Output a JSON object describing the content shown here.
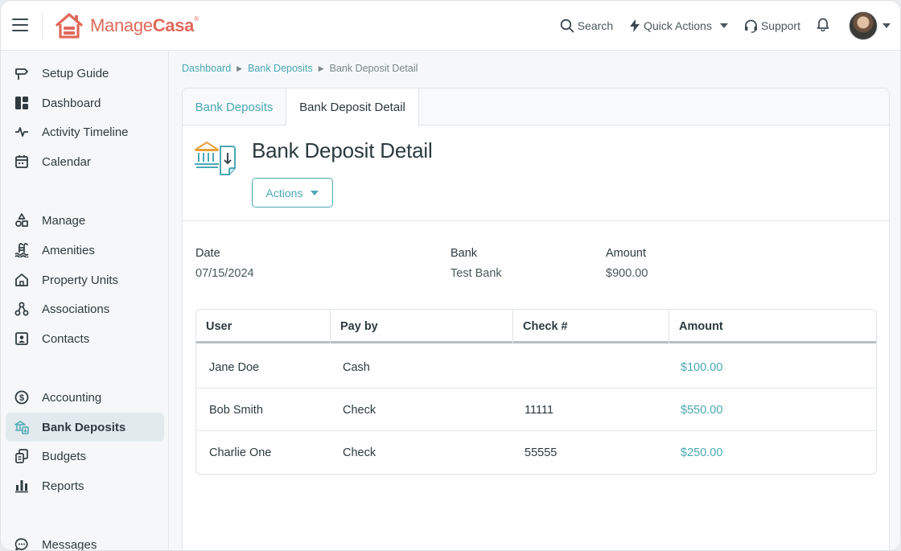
{
  "app": {
    "brand_prefix": "Manage",
    "brand_suffix": "Casa",
    "brand_mark": "®"
  },
  "topbar": {
    "search_label": "Search",
    "quick_actions_label": "Quick Actions",
    "support_label": "Support"
  },
  "sidebar": {
    "items": [
      {
        "label": "Setup Guide",
        "icon": "signpost-icon"
      },
      {
        "label": "Dashboard",
        "icon": "dashboard-icon"
      },
      {
        "label": "Activity Timeline",
        "icon": "pulse-icon"
      },
      {
        "label": "Calendar",
        "icon": "calendar-icon"
      },
      {
        "label": "Manage",
        "icon": "shapes-icon"
      },
      {
        "label": "Amenities",
        "icon": "pool-icon"
      },
      {
        "label": "Property Units",
        "icon": "house-icon"
      },
      {
        "label": "Associations",
        "icon": "network-icon"
      },
      {
        "label": "Contacts",
        "icon": "contact-card-icon"
      },
      {
        "label": "Accounting",
        "icon": "dollar-circle-icon"
      },
      {
        "label": "Bank Deposits",
        "icon": "bank-deposit-icon"
      },
      {
        "label": "Budgets",
        "icon": "budget-icon"
      },
      {
        "label": "Reports",
        "icon": "bar-chart-icon"
      },
      {
        "label": "Messages",
        "icon": "chat-icon"
      }
    ]
  },
  "breadcrumb": {
    "items": [
      "Dashboard",
      "Bank Deposits"
    ],
    "current": "Bank Deposit Detail"
  },
  "tabs": [
    {
      "label": "Bank Deposits"
    },
    {
      "label": "Bank Deposit Detail"
    }
  ],
  "detail": {
    "title": "Bank Deposit Detail",
    "actions_label": "Actions",
    "fields": {
      "date_label": "Date",
      "date_value": "07/15/2024",
      "bank_label": "Bank",
      "bank_value": "Test Bank",
      "amount_label": "Amount",
      "amount_value": "$900.00"
    }
  },
  "table": {
    "headers": [
      "User",
      "Pay by",
      "Check #",
      "Amount"
    ],
    "rows": [
      {
        "user": "Jane Doe",
        "pay_by": "Cash",
        "check": "",
        "amount": "$100.00"
      },
      {
        "user": "Bob Smith",
        "pay_by": "Check",
        "check": "11111",
        "amount": "$550.00"
      },
      {
        "user": "Charlie One",
        "pay_by": "Check",
        "check": "55555",
        "amount": "$250.00"
      }
    ]
  },
  "colors": {
    "accent": "#4aa8b4",
    "brand": "#e0695a",
    "active_nav_bg": "#e3eaed"
  }
}
